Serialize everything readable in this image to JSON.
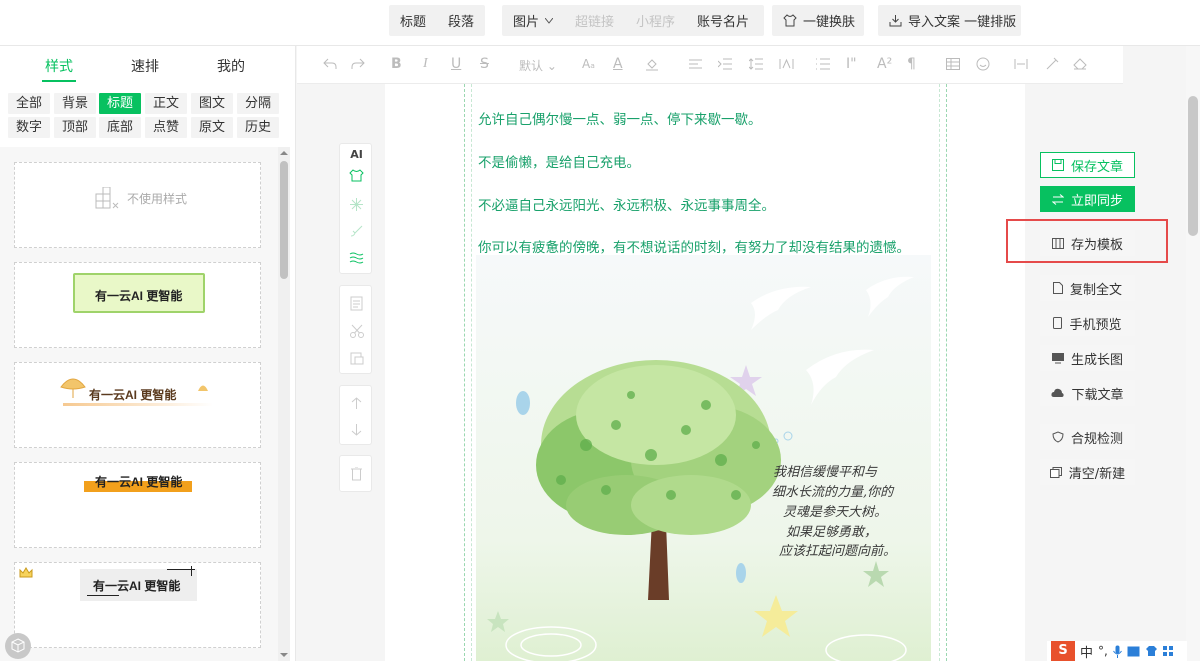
{
  "topbar": {
    "group1": [
      "标题",
      "段落"
    ],
    "group2": {
      "image": "图片",
      "link": "超链接",
      "mini": "小程序",
      "card": "账号名片"
    },
    "skin": "一键换肤",
    "import": "导入文案 一键排版"
  },
  "left_tabs": [
    "样式",
    "速排",
    "我的"
  ],
  "categories_row1": [
    "全部",
    "背景",
    "标题",
    "正文",
    "图文",
    "分隔"
  ],
  "categories_row2": [
    "数字",
    "顶部",
    "底部",
    "点赞",
    "原文",
    "历史"
  ],
  "active_category": "标题",
  "style_cards": {
    "none_label": "不使用样式",
    "sample_title": "有一云AI 更智能"
  },
  "editor_toolbar": {
    "font_size": "默认"
  },
  "side_tool": {
    "ai": "AI"
  },
  "article": {
    "paragraphs": [
      "允许自己偶尔慢一点、弱一点、停下来歇一歇。",
      "不是偷懒，是给自己充电。",
      "不必逼自己永远阳光、永远积极、永远事事周全。",
      "你可以有疲惫的傍晚，有不想说话的时刻，有努力了却没有结果的遗憾。"
    ],
    "handwriting": [
      "我相信缓慢平和与",
      "细水长流的力量,你的",
      "灵魂是参天大树。",
      "如果足够勇敢，",
      "应该扛起问题向前。"
    ]
  },
  "right_panel": {
    "save": "保存文章",
    "sync": "立即同步",
    "template": "存为模板",
    "copy": "复制全文",
    "preview": "手机预览",
    "long_image": "生成长图",
    "download": "下载文章",
    "check": "合规检测",
    "clear": "清空/新建"
  },
  "ime": {
    "lang": "中"
  },
  "colors": {
    "accent": "#07c160",
    "article_text": "#19a16b",
    "highlight": "#e54a4a"
  }
}
